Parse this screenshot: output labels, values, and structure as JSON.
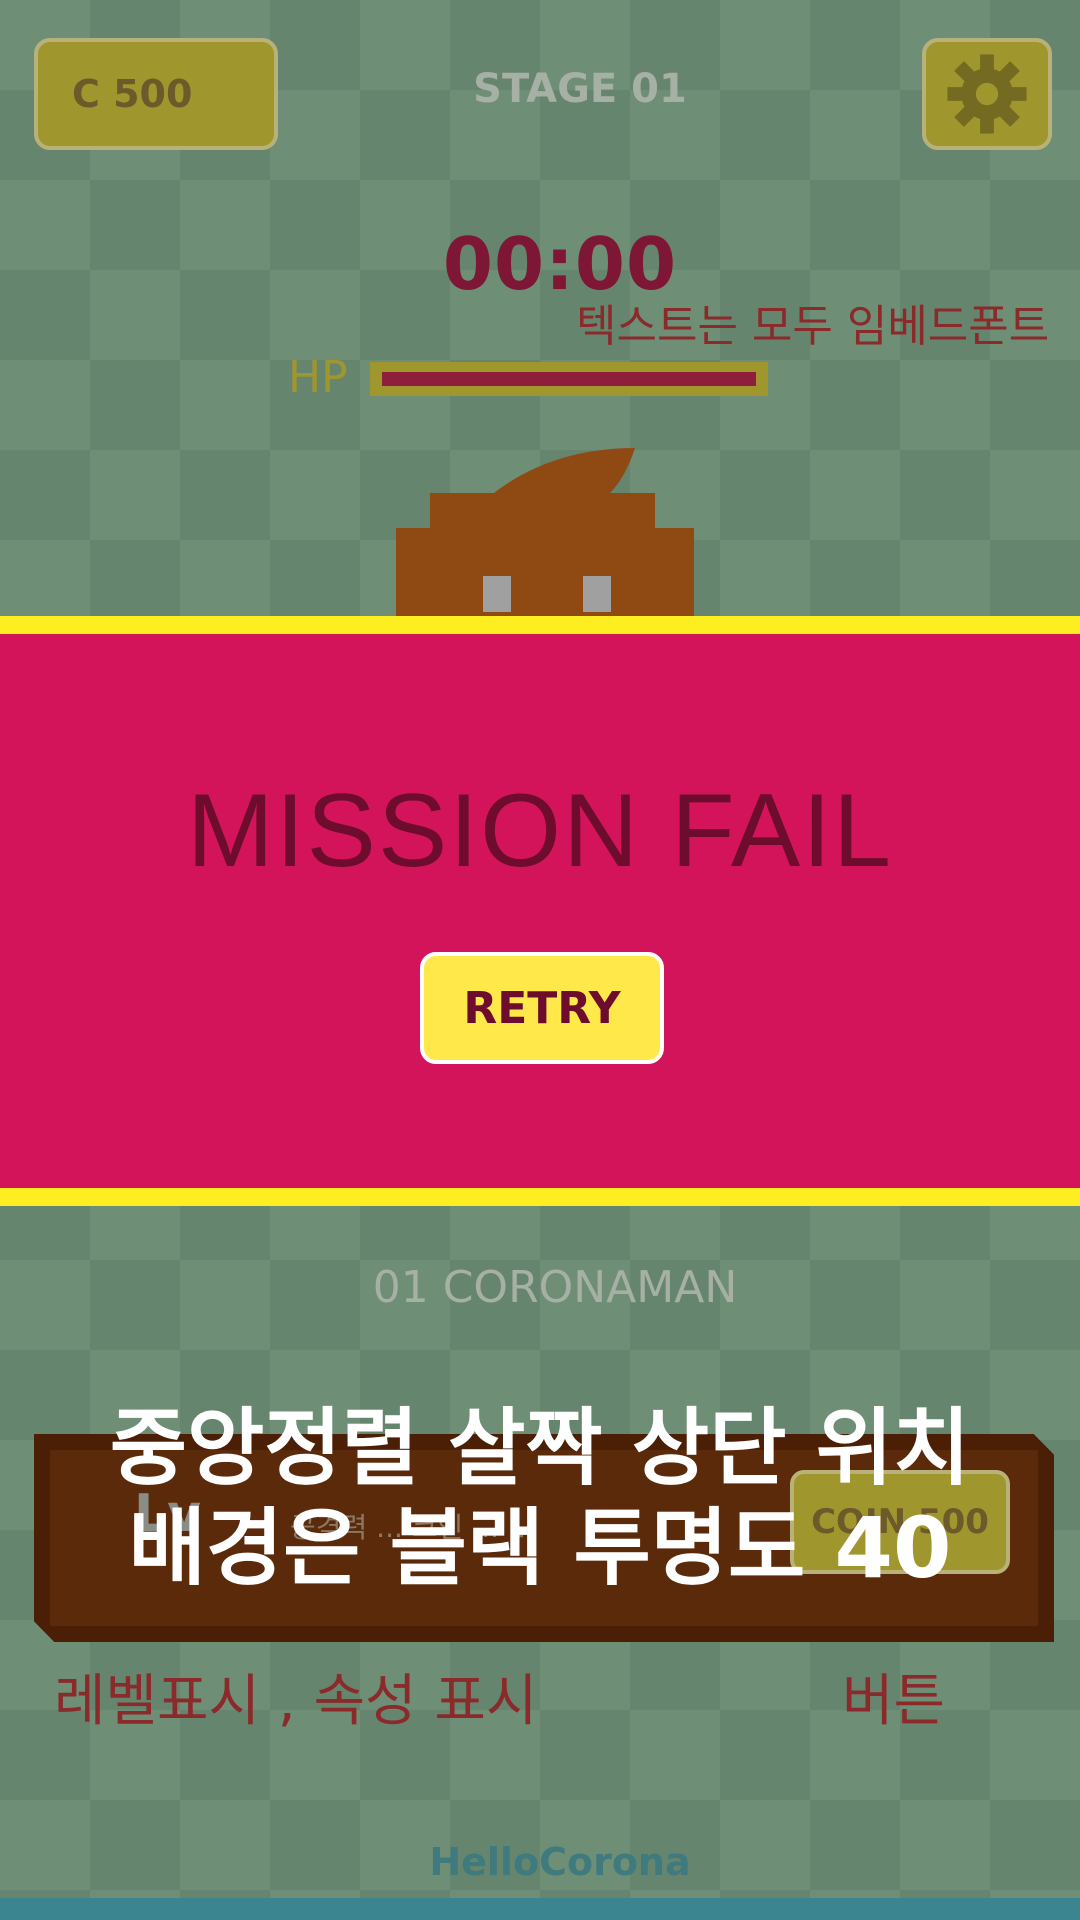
{
  "header": {
    "coins": "C 500",
    "stage": "STAGE 01",
    "settings_icon": "gear-icon"
  },
  "hud": {
    "timer": "00:00",
    "hp_label": "HP",
    "hp_fraction": 1.0,
    "note_font": "텍스트는 모두 임베드폰트"
  },
  "fail_panel": {
    "title": "MISSION FAIL",
    "retry_label": "RETRY"
  },
  "character": {
    "name": "01 CORONAMAN"
  },
  "info": {
    "level_label": "Lv",
    "stats_label": "공격력 ... 코인 ... 1",
    "cost_label": "COIN 500"
  },
  "notes": {
    "overlay": "중앙정렬 살짝 상단 위치\n배경은 블랙 투명도 40",
    "level_attr": "레벨표시 , 속성 표시",
    "button": "버튼"
  },
  "footer": {
    "title": "HelloCorona"
  },
  "colors": {
    "background": "#6e8f76",
    "panel": "#d4145a",
    "panel_border": "#fdee21",
    "button_yellow": "#ffe94a",
    "coin_box": "#a0962e",
    "character": "#8f4a14",
    "info_box": "#5b2a0a"
  }
}
